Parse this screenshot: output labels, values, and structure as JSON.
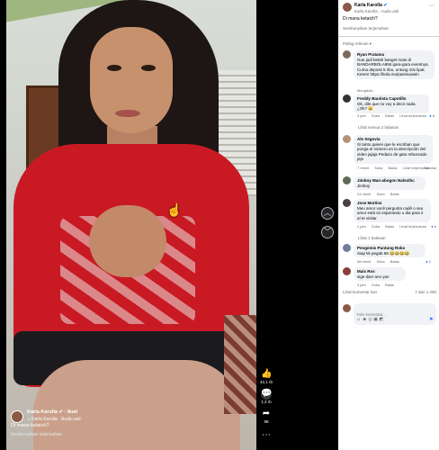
{
  "overlay": {
    "author_name": "Karla Karolla",
    "dot": "·",
    "follow": "Ikuti",
    "audio": "Karla Karolla · Audio asli",
    "caption": "Di mana ketaich?",
    "translate": "Sembunyikan terjemahan"
  },
  "rail": {
    "like_count": "42,1 rb",
    "comment_count": "1,3 rb",
    "share_count": "88"
  },
  "panel": {
    "author_name": "Karla Karolla",
    "author_sub": "Karla Karolla · Audio asli",
    "caption": "Di mana ketaich?",
    "translate": "Sembunyikan terjemahan",
    "sort": "Paling relevan",
    "comments": [
      {
        "name": "Ryan Pratama",
        "text": "Gue jadi betah banget main di BANDARBOLA855 gara-gara eventnya. Cuma deposit 5 ribu, untung 10x lipat. Keren! https://bola.mu/pasimaxwin",
        "meta": [
          "Mengikuti..."
        ]
      },
      {
        "name": "Freddy Bautista Capotillo",
        "text": "Ok, dile que no voy a decir nada. ¿Ok? 😄",
        "meta": [
          "9 jam",
          "Suka",
          "Balas",
          "Lihat terjemahan"
        ],
        "reactions": "6",
        "replies": "Lihat semua 2 balasan"
      },
      {
        "name": "Ale Segovia",
        "text": "Si tanto quiere que le escriban que ponga el número en la descripción del video jajaja Pedazo de gato rebuscado jeje",
        "meta": [
          "7 menit",
          "Suka",
          "Balas",
          "Lihat terjemahan"
        ],
        "reactions": "Disukai"
      },
      {
        "name": "Jimboy Man-abogon Nalsolhc",
        "text": "Jimboy",
        "meta": [
          "24 menit",
          "Suka",
          "Balas"
        ]
      },
      {
        "name": "Jose Martins",
        "text": "Meu amor você pergunta cadê o seu amor está só esperando o dia para ir aí te visitar",
        "meta": [
          "2 jam",
          "Suka",
          "Balas",
          "Lihat terjemahan"
        ],
        "reactions": "6",
        "replies": "Lihat 1 balasan"
      },
      {
        "name": "Pengemis Puntung Roko",
        "text": "Siap kk pegab 68 😂😂😂😂",
        "meta": [
          "58 menit",
          "Suka",
          "Balas"
        ],
        "reactions": "2"
      },
      {
        "name": "Mais Ros",
        "text": "sige dasr ano yan",
        "meta": [
          "3 jam",
          "Suka",
          "Balas"
        ]
      }
    ],
    "more_comments": "Lihat komentar lain",
    "count": "7 dari 1.250",
    "input_placeholder": "Tulis komentar..."
  }
}
